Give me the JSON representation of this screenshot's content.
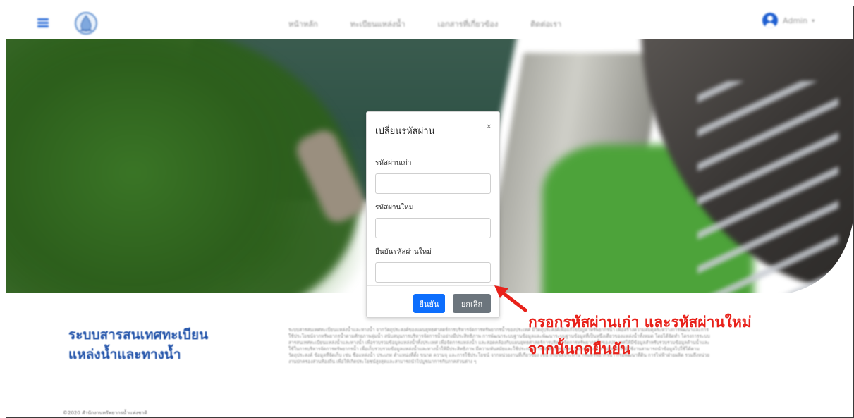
{
  "navbar": {
    "links": [
      "หน้าหลัก",
      "ทะเบียนแหล่งน้ำ",
      "เอกสารที่เกี่ยวข้อง",
      "ติดต่อเรา"
    ],
    "user_name": "Admin",
    "caret": "▾"
  },
  "footer": {
    "title_line1": "ระบบสารสนเทศทะเบียน",
    "title_line2": "แหล่งน้ำและทางน้ำ",
    "description": "ระบบสารสนเทศทะเบียนแหล่งน้ำและทางน้ำ จากวัตถุประสงค์ของแผนยุทธศาสตร์การบริหารจัดการทรัพยากรน้ำของประเทศ มีวัตถุประสงค์เพื่อแก้ไขปัญหาทรัพยากรน้ำ เพื่อสร้างความสมดุลระหว่างการพัฒนาและการใช้ประโยชน์จากทรัพยากรน้ำตามศักยภาพลุ่มน้ำ สนับสนุนการบริหารจัดการน้ำอย่างมีประสิทธิภาพ การพัฒนาระบบฐานข้อมูลและพัฒนาระบบฐานข้อมูลที่เป็นหนึ่งเดียวของแหล่งน้ำทั้งหมด โดยได้จัดทำ โครงการระบบสารสนเทศทะเบียนแหล่งน้ำและทางน้ำ เพื่อรวบรวมข้อมูลแหล่งน้ำทั้งประเทศ เพื่อจัดการแหล่งน้ำ และสอดคล้องกับแผนยุทธศาสตร์การบริหารจัดการทรัพยากรน้ำของประเทศให้มีข้อมูลสำหรับรวบรวมข้อมูลด้านน้ำและใช้ในการบริหารจัดการทรัพยากรน้ำ เพื่อเก็บรวบรวมข้อมูลแหล่งน้ำและทางน้ำให้มีประสิทธิภาพ มีความทันสมัยและใช้ประกอบการตัดสินใจของหน่วยงานต่าง ๆ รวมถึงเพื่อให้ผู้ใช้งานสามารถนำข้อมูลไปใช้ได้ตามวัตถุประสงค์ ข้อมูลที่จัดเก็บ เช่น ชื่อแหล่งน้ำ ประเภท ตำแหน่งที่ตั้ง ขนาด ความจุ และการใช้ประโยชน์ จากหน่วยงานที่เกี่ยวข้อง เช่น กรมชลประทาน กรมทรัพยากรน้ำ กรมพัฒนาที่ดิน การไฟฟ้าฝ่ายผลิต รวมถึงหน่วยงานปกครองส่วนท้องถิ่น เพื่อให้เกิดประโยชน์สูงสุดและสามารถนำไปบูรณาการกับภาคส่วนต่าง ๆ",
    "copyright": "©2020 สำนักงานทรัพยากรน้ำแห่งชาติ"
  },
  "modal": {
    "title": "เปลี่ยนรหัสผ่าน",
    "close_label": "×",
    "fields": [
      {
        "label": "รหัสผ่านเก่า",
        "value": ""
      },
      {
        "label": "รหัสผ่านใหม่",
        "value": ""
      },
      {
        "label": "ยืนยันรหัสผ่านใหม่",
        "value": ""
      }
    ],
    "confirm_label": "ยืนยัน",
    "cancel_label": "ยกเลิก"
  },
  "annotation": {
    "line1": "กรอกรหัสผ่านเก่า และรหัสผ่านใหม่",
    "line2": "จากนั้นกดยืนยัน",
    "color": "#e8211a"
  },
  "colors": {
    "primary": "#0d6efd",
    "secondary": "#6c757d",
    "brand_blue": "#1e50a8"
  }
}
